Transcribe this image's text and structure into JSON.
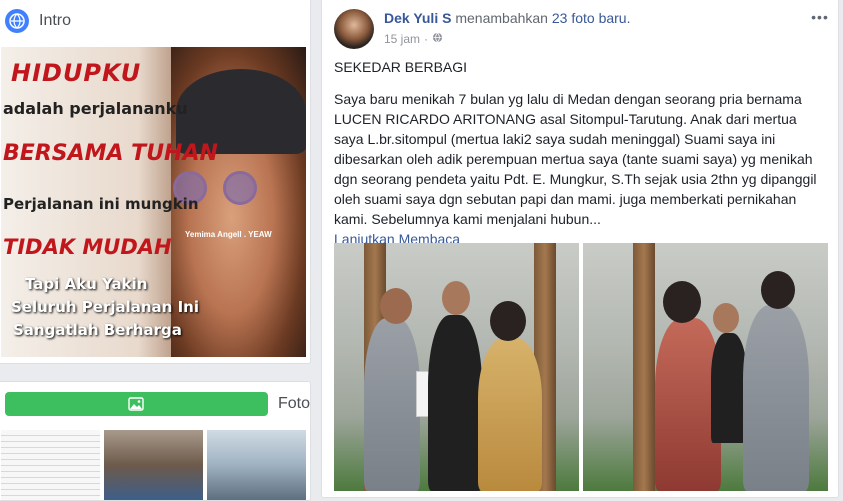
{
  "intro": {
    "title": "Intro",
    "icon": "globe-icon",
    "meme": {
      "line1": "HIDUPKU",
      "line2": "adalah perjalananku",
      "line3": "BERSAMA TUHAN",
      "line4": "Perjalanan ini mungkin",
      "line5": "TIDAK MUDAH",
      "line6": "Tapi Aku Yakin",
      "line7": "Seluruh Perjalanan Ini",
      "line8": "Sangatlah Berharga",
      "watermark": "Yemima Angell . YEAW"
    }
  },
  "foto": {
    "title": "Foto",
    "icon": "photo-icon"
  },
  "post": {
    "author": "Dek Yuli S",
    "action": "menambahkan",
    "count_text": "23 foto baru.",
    "time": "15 jam",
    "separator": "·",
    "privacy_icon": "globe-icon",
    "heading": "SEKEDAR BERBAGI",
    "body": "Saya baru menikah 7 bulan yg lalu di Medan dengan seorang pria bernama LUCEN RICARDO ARITONANG asal Sitompul-Tarutung. Anak dari mertua saya L.br.sitompul (mertua laki2 saya sudah meninggal) Suami saya ini dibesarkan oleh adik perempuan mertua saya (tante suami saya) yg menikah dgn seorang pendeta yaitu Pdt. E. Mungkur, S.Th sejak usia 2thn yg dipanggil oleh suami saya dgn sebutan papi dan mami. juga memberkati pernikahan kami. Sebelumnya kami menjalani hubun...",
    "see_more": "Lanjutkan Membaca",
    "more_icon": "ellipsis-icon"
  }
}
